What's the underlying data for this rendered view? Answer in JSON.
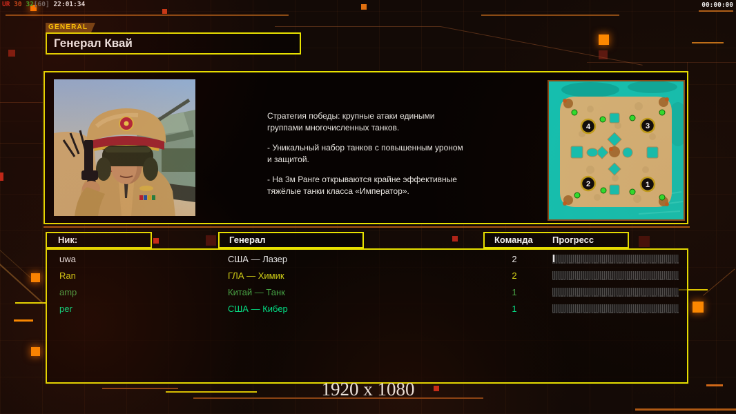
{
  "overlay": {
    "parts": [
      {
        "text": "UR ",
        "color": "#c8281c"
      },
      {
        "text": "30 ",
        "color": "#c84a1c"
      },
      {
        "text": "32",
        "color": "#3aa42a"
      },
      {
        "text": "[60] ",
        "color": "#6a6a6a"
      },
      {
        "text": "22:01:34",
        "color": "#e6e6e6"
      }
    ],
    "timer": "00:00:00"
  },
  "header": {
    "tab": "GENERAL",
    "title": "Генерал Квай"
  },
  "info": {
    "paragraphs": [
      "Стратегия победы: крупные атаки едиными\n группами многочисленных танков.",
      "- Уникальный набор танков с повышенным уроном\n и защитой.",
      "- На 3м Ранге открываются крайне эффективные\n тяжёлые танки класса «Император»."
    ]
  },
  "map": {
    "positions": [
      {
        "label": "4"
      },
      {
        "label": "3"
      },
      {
        "label": "2"
      },
      {
        "label": "1"
      }
    ]
  },
  "table": {
    "headers": {
      "nick": "Ник:",
      "general": "Генерал",
      "team": "Команда",
      "progress": "Прогресс"
    },
    "rows": [
      {
        "nick": "uwa",
        "general": "США — Лазер",
        "team": "2",
        "color": "#e6e6e6"
      },
      {
        "nick": "Ran",
        "general": "ГЛА — Химик",
        "team": "2",
        "color": "#d2d216"
      },
      {
        "nick": "amp",
        "general": "Китай — Танк",
        "team": "1",
        "color": "#46a546"
      },
      {
        "nick": "per",
        "general": "США — Кибер",
        "team": "1",
        "color": "#00df85"
      }
    ]
  },
  "footer": {
    "resolution": "1920 x 1080"
  },
  "colors": {
    "accent_yellow": "#e8e200",
    "accent_orange": "#ff8a00"
  }
}
